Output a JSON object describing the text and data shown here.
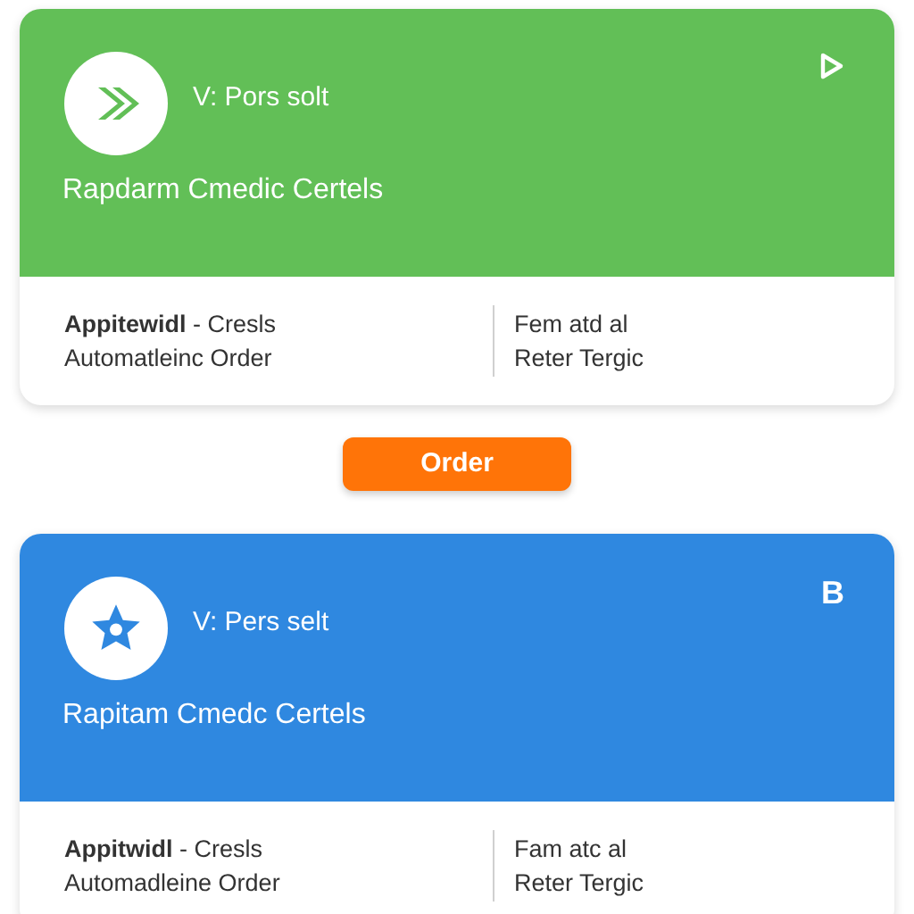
{
  "cards": [
    {
      "color": "#62bf57",
      "kind": "forward",
      "corner": {
        "kind": "play"
      },
      "subtitle": "V: Pors solt",
      "title": "Rapdarm Cmedic Certels",
      "left_lines": [
        "**Appitewidl** - Cresls",
        "Automatleinc Order"
      ],
      "right_lines": [
        "Fem atd al",
        "Reter Tergic"
      ]
    },
    {
      "color": "#2f88e0",
      "kind": "favorite",
      "corner": {
        "kind": "text",
        "text": "B"
      },
      "subtitle": "V: Pers selt",
      "title": "Rapitam Cmedc Certels",
      "left_lines": [
        "**Appitwidl** - Cresls",
        "Automadleine Order"
      ],
      "right_lines": [
        "Fam atc al",
        "Reter Tergic"
      ]
    }
  ],
  "order_button": {
    "label": "Order"
  }
}
